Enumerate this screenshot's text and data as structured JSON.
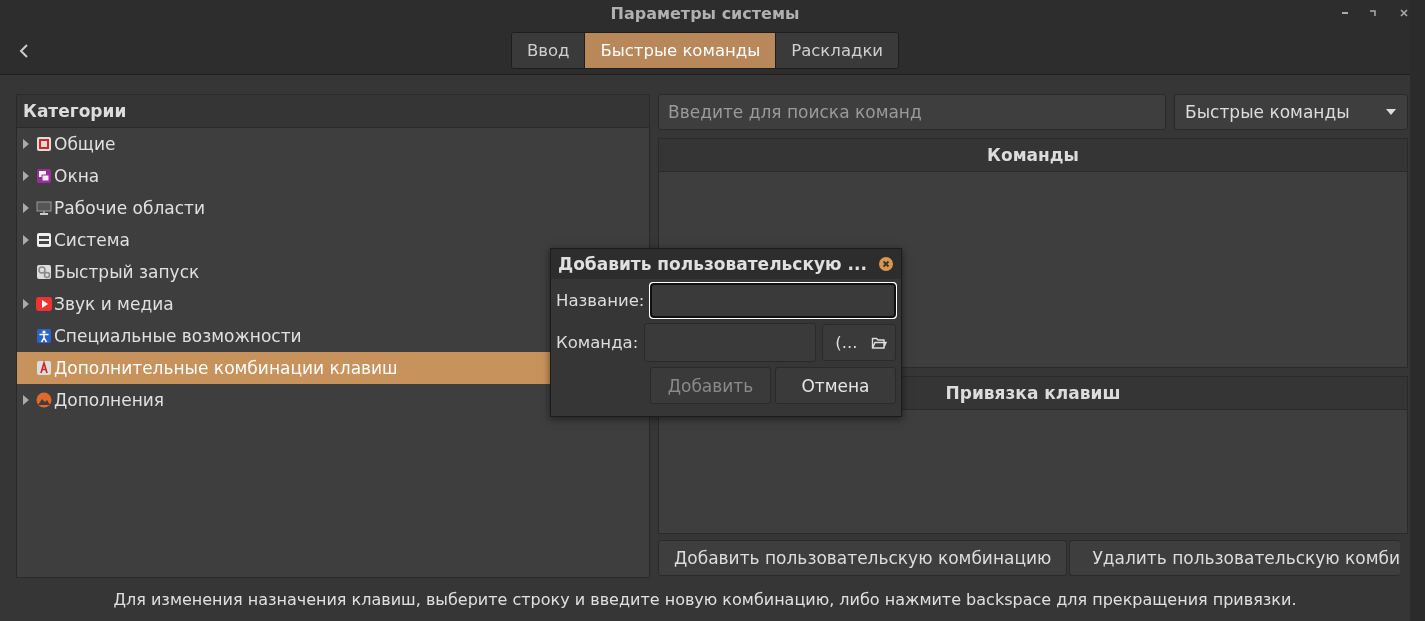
{
  "window": {
    "title": "Параметры системы"
  },
  "tabs": [
    {
      "label": "Ввод",
      "selected": false
    },
    {
      "label": "Быстрые команды",
      "selected": true
    },
    {
      "label": "Раскладки",
      "selected": false
    }
  ],
  "categories": {
    "title": "Категории",
    "items": [
      {
        "label": "Общие",
        "kind": "general",
        "expandable": true,
        "selected": false
      },
      {
        "label": "Окна",
        "kind": "windows",
        "expandable": true,
        "selected": false
      },
      {
        "label": "Рабочие области",
        "kind": "workspaces",
        "expandable": true,
        "selected": false
      },
      {
        "label": "Система",
        "kind": "system",
        "expandable": true,
        "selected": false
      },
      {
        "label": "Быстрый запуск",
        "kind": "launch",
        "expandable": false,
        "selected": false
      },
      {
        "label": "Звук и медиа",
        "kind": "media",
        "expandable": true,
        "selected": false
      },
      {
        "label": "Специальные возможности",
        "kind": "accessibility",
        "expandable": false,
        "selected": false
      },
      {
        "label": "Дополнительные комбинации клавиш",
        "kind": "custom",
        "expandable": false,
        "selected": true
      },
      {
        "label": "Дополнения",
        "kind": "addons",
        "expandable": true,
        "selected": false
      }
    ]
  },
  "search": {
    "placeholder": "Введите для поиска команд"
  },
  "filter": {
    "value": "Быстрые команды"
  },
  "commands": {
    "title": "Команды"
  },
  "bindings": {
    "title": "Привязка клавиш"
  },
  "buttons": [
    {
      "label": "Добавить пользовательскую комбинацию"
    },
    {
      "label": "Удалить пользовательскую комби"
    }
  ],
  "dialog": {
    "title": "Добавить пользовательскую ...",
    "name_label": "Название:",
    "command_label": "Команда:",
    "file_button": "(...",
    "buttons": [
      {
        "label": "Добавить",
        "disabled": true
      },
      {
        "label": "Отмена",
        "disabled": false
      }
    ]
  },
  "status_text": "Для изменения назначения клавиш, выберите строку и введите новую комбинацию, либо нажмите backspace для прекращения привязки."
}
